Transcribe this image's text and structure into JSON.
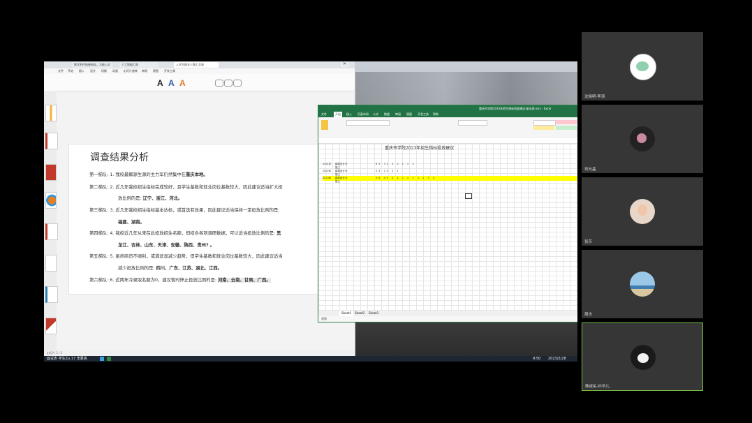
{
  "ppt": {
    "tabs": [
      "数学附件链接网站，万能公式",
      "人工智能汇报",
      "入学生报名人数汇总表"
    ],
    "menu": [
      "文件",
      "开始",
      "插入",
      "设计",
      "切换",
      "动画",
      "幻灯片放映",
      "审阅",
      "视图",
      "开发工具"
    ],
    "slide_title": "调查结果分析",
    "lines": [
      {
        "team": "第一梯队:",
        "text": "1. 我校最解源生源的主力军仍然集中在",
        "hi": "重庆本地。"
      },
      {
        "team": "第二梯队:",
        "text": "2. 近几年我校招生指标完成较好，且学生基数和就业岗位基数较大，因此建议适当扩大投"
      },
      {
        "team": "",
        "text": "放比例的是: ",
        "hi": "辽宁、浙江、河北。"
      },
      {
        "team": "第三梯队:",
        "text": "3. 近几年我校招生指标基本达标，或首选有效果，因此建议适当保持一定投放比例的是:"
      },
      {
        "team": "",
        "text": "",
        "hi": "福建、湖南。"
      },
      {
        "team": "第四梯队:",
        "text": "4. 我校近几年从来在此投放招生名额，但结合各项调研数据，可以适当投放比例的是: ",
        "hi": "黑"
      },
      {
        "team": "",
        "text": "",
        "hi": "龙江、吉林、山东、天津、安徽、陕西、贵州? 。"
      },
      {
        "team": "第五梯队:",
        "text": "5. 虽然商贸不顺利，或道途显减少趋势，但学生基数和就业岗位基数较大，因此建议适当"
      },
      {
        "team": "",
        "text": "减少投放比例的是: ",
        "hi": "四川、广东、江苏、湖北、江西。"
      },
      {
        "team": "第六梯队:",
        "text": "6. 近两年冷录取名额为0，建议暂时停止投放比例的是: ",
        "hi": "河南、云南、甘肃、广西。"
      }
    ],
    "status": "幻灯片 1 / 1"
  },
  "excel": {
    "title": "重庆市学院2023年招生指标投放建议-副本表.xlsx - Excel",
    "menu": [
      "文件",
      "开始",
      "插入",
      "页面布局",
      "公式",
      "数据",
      "审阅",
      "视图",
      "开发工具",
      "帮助"
    ],
    "sheet_title": "重庆市学院2023年招生指标投放建议",
    "sheets": [
      "Sheet1",
      "Sheet2",
      "Sheet3"
    ],
    "status": "就绪",
    "rows": [
      {
        "year": "2021年",
        "name": "建筑设计与施工",
        "vals": "65  32  3  2  1  2  2"
      },
      {
        "year": "2022年",
        "name": "建筑设计与施工",
        "vals": "34  25  2  1"
      },
      {
        "year": "2023年",
        "name": "建筑设计与施工",
        "vals": "56  40  3  2  1  2  1  2  1  3  2"
      }
    ]
  },
  "taskbar": {
    "left": "面试表 学生Zu 17 李慕真",
    "time": "9:50",
    "date": "2023/2/28"
  },
  "participants": [
    {
      "name": "沈晓明·李涛",
      "avatar": "cartoon"
    },
    {
      "name": "刘元晶",
      "avatar": "flower"
    },
    {
      "name": "张莎",
      "avatar": "child"
    },
    {
      "name": "周杰",
      "avatar": "beach"
    },
    {
      "name": "韩成佑·孙华儿",
      "avatar": "cat"
    }
  ]
}
